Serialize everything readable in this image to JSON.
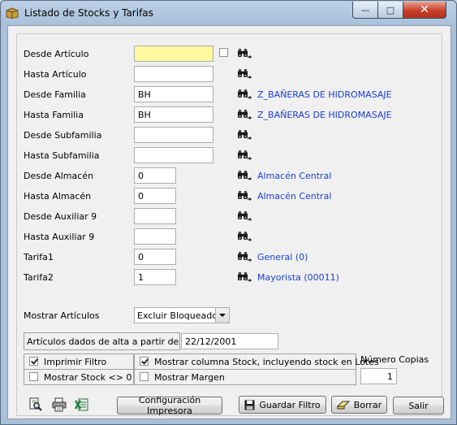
{
  "window": {
    "title": "Listado de Stocks y Tarifas",
    "minimize_glyph": "—",
    "maximize_glyph": "□",
    "close_glyph": "✕"
  },
  "fields": [
    {
      "label": "Desde Artículo",
      "value": "",
      "desc": ""
    },
    {
      "label": "Hasta Artículo",
      "value": "",
      "desc": ""
    },
    {
      "label": "Desde Familia",
      "value": "BH",
      "desc": "Z_BAÑERAS DE HIDROMASAJE"
    },
    {
      "label": "Hasta Familia",
      "value": "BH",
      "desc": "Z_BAÑERAS DE HIDROMASAJE"
    },
    {
      "label": "Desde Subfamilia",
      "value": "",
      "desc": ""
    },
    {
      "label": "Hasta Subfamilia",
      "value": "",
      "desc": ""
    },
    {
      "label": "Desde Almacén",
      "value": "0",
      "desc": "Almacén Central"
    },
    {
      "label": "Hasta Almacén",
      "value": "0",
      "desc": "Almacén Central"
    },
    {
      "label": "Desde Auxiliar 9",
      "value": "",
      "desc": ""
    },
    {
      "label": "Hasta Auxiliar 9",
      "value": "",
      "desc": ""
    },
    {
      "label": "Tarifa1",
      "value": "0",
      "desc": "General (0)"
    },
    {
      "label": "Tarifa2",
      "value": "1",
      "desc": "Mayorista (00011)"
    }
  ],
  "mostrar": {
    "label": "Mostrar Artículos",
    "selected": "Excluir Bloqueados"
  },
  "alta": {
    "label": "Artículos dados de alta a partir de",
    "value": "22/12/2001"
  },
  "options": {
    "imprimir_filtro": {
      "label": "Imprimir Filtro",
      "checked": true
    },
    "mostrar_stock": {
      "label": "Mostrar Stock <> 0",
      "checked": false
    },
    "mostrar_columna": {
      "label": "Mostrar columna Stock, incluyendo stock en Lotes",
      "checked": true
    },
    "mostrar_margen": {
      "label": "Mostrar Margen",
      "checked": false
    }
  },
  "copias": {
    "label": "Número Copias",
    "value": "1"
  },
  "buttons": {
    "config": "Configuración Impresora",
    "guardar": "Guardar Filtro",
    "borrar": "Borrar",
    "salir": "Salir"
  },
  "icons": {
    "app": "folder-app-icon",
    "search": "binoculars-search-icon",
    "preview": "print-preview-icon",
    "print": "printer-icon",
    "excel": "excel-export-icon"
  },
  "colors": {
    "description_text": "#1a3ecf",
    "highlight_input": "#fff89e",
    "close_button": "#c6402a"
  }
}
